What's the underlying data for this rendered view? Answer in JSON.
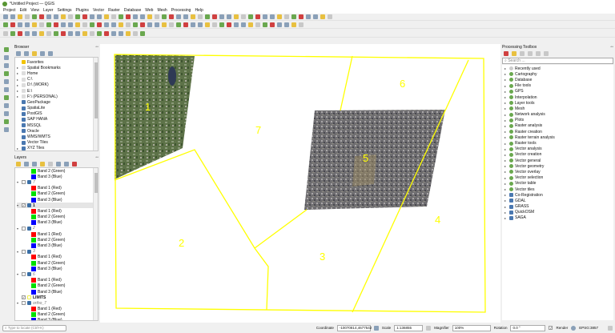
{
  "window": {
    "title": "*Untitled Project — QGIS"
  },
  "menu": [
    "Project",
    "Edit",
    "View",
    "Layer",
    "Settings",
    "Plugins",
    "Vector",
    "Raster",
    "Database",
    "Web",
    "Mesh",
    "Processing",
    "Help"
  ],
  "browser": {
    "title": "Browser",
    "items": [
      {
        "label": "Favorites",
        "icon": "star-icon",
        "expand": false
      },
      {
        "label": "Spatial Bookmarks",
        "icon": "bookmark-icon",
        "expand": true
      },
      {
        "label": "Home",
        "icon": "home-folder-icon",
        "expand": true
      },
      {
        "label": "C:\\",
        "icon": "drive-icon",
        "expand": true
      },
      {
        "label": "D:\\ (WORK)",
        "icon": "drive-icon",
        "expand": true
      },
      {
        "label": "E:\\",
        "icon": "drive-icon",
        "expand": true
      },
      {
        "label": "F:\\ (PERSONAL)",
        "icon": "drive-icon",
        "expand": true
      },
      {
        "label": "GeoPackage",
        "icon": "geopackage-icon",
        "expand": false
      },
      {
        "label": "SpatiaLite",
        "icon": "spatialite-icon",
        "expand": false
      },
      {
        "label": "PostGIS",
        "icon": "postgis-icon",
        "expand": false
      },
      {
        "label": "SAP HANA",
        "icon": "database-icon",
        "expand": false
      },
      {
        "label": "MSSQL",
        "icon": "mssql-icon",
        "expand": false
      },
      {
        "label": "Oracle",
        "icon": "oracle-icon",
        "expand": false
      },
      {
        "label": "WMS/WMTS",
        "icon": "globe-icon",
        "expand": false
      },
      {
        "label": "Vector Tiles",
        "icon": "vector-tiles-icon",
        "expand": false
      },
      {
        "label": "XYZ Tiles",
        "icon": "xyz-tiles-icon",
        "expand": true
      }
    ]
  },
  "layers": {
    "title": "Layers",
    "rows": [
      {
        "type": "band",
        "label": "Band 2 (Green)",
        "color": "#00e000"
      },
      {
        "type": "band",
        "label": "Band 3 (Blue)",
        "color": "#0000ff"
      },
      {
        "type": "layer",
        "label": "7",
        "checked": false
      },
      {
        "type": "band",
        "label": "Band 1 (Red)",
        "color": "#ff0000"
      },
      {
        "type": "band",
        "label": "Band 2 (Green)",
        "color": "#00e000"
      },
      {
        "type": "band",
        "label": "Band 3 (Blue)",
        "color": "#0000ff"
      },
      {
        "type": "layer",
        "label": "1",
        "checked": true
      },
      {
        "type": "band",
        "label": "Band 1 (Red)",
        "color": "#ff0000"
      },
      {
        "type": "band",
        "label": "Band 2 (Green)",
        "color": "#00e000"
      },
      {
        "type": "band",
        "label": "Band 3 (Blue)",
        "color": "#0000ff"
      },
      {
        "type": "layer",
        "label": "2",
        "checked": false
      },
      {
        "type": "band",
        "label": "Band 1 (Red)",
        "color": "#ff0000"
      },
      {
        "type": "band",
        "label": "Band 2 (Green)",
        "color": "#00e000"
      },
      {
        "type": "band",
        "label": "Band 3 (Blue)",
        "color": "#0000ff"
      },
      {
        "type": "layer",
        "label": "3",
        "checked": false
      },
      {
        "type": "band",
        "label": "Band 1 (Red)",
        "color": "#ff0000"
      },
      {
        "type": "band",
        "label": "Band 2 (Green)",
        "color": "#00e000"
      },
      {
        "type": "band",
        "label": "Band 3 (Blue)",
        "color": "#0000ff"
      },
      {
        "type": "layer",
        "label": "6",
        "checked": false
      },
      {
        "type": "band",
        "label": "Band 1 (Red)",
        "color": "#ff0000"
      },
      {
        "type": "band",
        "label": "Band 2 (Green)",
        "color": "#00e000"
      },
      {
        "type": "band",
        "label": "Band 3 (Blue)",
        "color": "#0000ff"
      },
      {
        "type": "vector",
        "label": "LIMITS",
        "checked": true
      },
      {
        "type": "layer",
        "label": "ortho_7",
        "checked": false
      },
      {
        "type": "band",
        "label": "Band 1 (Red)",
        "color": "#ff0000"
      },
      {
        "type": "band",
        "label": "Band 2 (Green)",
        "color": "#00e000"
      },
      {
        "type": "band",
        "label": "Band 3 (Blue)",
        "color": "#0000ff"
      }
    ]
  },
  "map": {
    "zone_labels": [
      "1",
      "2",
      "3",
      "4",
      "5",
      "6",
      "7"
    ],
    "limits_color": "#ffff00"
  },
  "toolbox": {
    "title": "Processing Toolbox",
    "search_placeholder": "Search ...",
    "items": [
      {
        "label": "Recently used",
        "icon": "clock-icon"
      },
      {
        "label": "Cartography",
        "icon": "qgis-icon"
      },
      {
        "label": "Database",
        "icon": "qgis-icon"
      },
      {
        "label": "File tools",
        "icon": "qgis-icon"
      },
      {
        "label": "GPS",
        "icon": "qgis-icon"
      },
      {
        "label": "Interpolation",
        "icon": "qgis-icon"
      },
      {
        "label": "Layer tools",
        "icon": "qgis-icon"
      },
      {
        "label": "Mesh",
        "icon": "qgis-icon"
      },
      {
        "label": "Network analysis",
        "icon": "qgis-icon"
      },
      {
        "label": "Plots",
        "icon": "qgis-icon"
      },
      {
        "label": "Raster analysis",
        "icon": "qgis-icon"
      },
      {
        "label": "Raster creation",
        "icon": "qgis-icon"
      },
      {
        "label": "Raster terrain analysis",
        "icon": "qgis-icon"
      },
      {
        "label": "Raster tools",
        "icon": "qgis-icon"
      },
      {
        "label": "Vector analysis",
        "icon": "qgis-icon"
      },
      {
        "label": "Vector creation",
        "icon": "qgis-icon"
      },
      {
        "label": "Vector general",
        "icon": "qgis-icon"
      },
      {
        "label": "Vector geometry",
        "icon": "qgis-icon"
      },
      {
        "label": "Vector overlay",
        "icon": "qgis-icon"
      },
      {
        "label": "Vector selection",
        "icon": "qgis-icon"
      },
      {
        "label": "Vector table",
        "icon": "qgis-icon"
      },
      {
        "label": "Vector tiles",
        "icon": "qgis-icon"
      },
      {
        "label": "Co-Registration",
        "icon": "coregistration-icon"
      },
      {
        "label": "GDAL",
        "icon": "gdal-icon"
      },
      {
        "label": "GRASS",
        "icon": "grass-icon"
      },
      {
        "label": "QuickOSM",
        "icon": "quickosm-icon"
      },
      {
        "label": "SAGA",
        "icon": "saga-icon"
      }
    ]
  },
  "status": {
    "locator_placeholder": "Type to locate (Ctrl+K)",
    "coordinate_label": "Coordinate",
    "coordinate": "-10070814,4677542",
    "scale_label": "Scale",
    "scale": "1:136855",
    "magnifier_label": "Magnifier",
    "magnifier": "100%",
    "rotation_label": "Rotation",
    "rotation": "0.0 °",
    "render_label": "Render",
    "render_checked": true,
    "crs": "EPSG:3857"
  }
}
